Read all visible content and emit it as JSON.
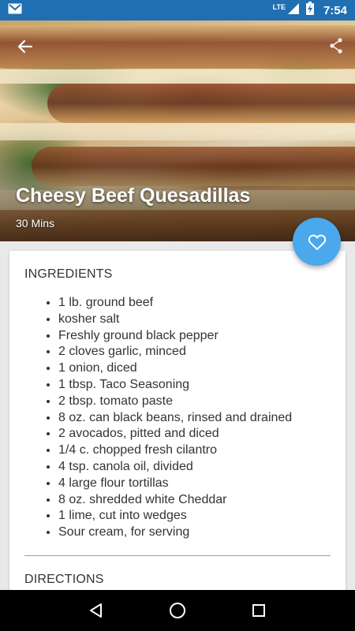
{
  "status_bar": {
    "time": "7:54",
    "network": "LTE",
    "icons": [
      "gmail-icon",
      "lte-signal-icon",
      "battery-charging-icon"
    ],
    "color": "#1f6fb2"
  },
  "hero": {
    "title": "Cheesy Beef Quesadillas",
    "time": "30 Mins"
  },
  "favorite": {
    "icon": "heart-outline-icon",
    "color": "#4aa8ec"
  },
  "ingredients": {
    "title": "INGREDIENTS",
    "items": [
      "1 lb. ground beef",
      "kosher salt",
      "Freshly ground black pepper",
      "2 cloves garlic, minced",
      "1 onion, diced",
      "1 tbsp. Taco Seasoning",
      "2 tbsp. tomato paste",
      "8 oz. can black beans, rinsed and drained",
      "2 avocados, pitted and diced",
      "1/4 c. chopped fresh cilantro",
      "4 tsp. canola oil, divided",
      "4 large flour tortillas",
      "8 oz. shredded white Cheddar",
      "1 lime, cut into wedges",
      "Sour cream, for serving"
    ]
  },
  "directions": {
    "title": "DIRECTIONS"
  },
  "nav": {
    "icons": [
      "back-triangle-icon",
      "home-circle-icon",
      "recents-square-icon"
    ]
  }
}
